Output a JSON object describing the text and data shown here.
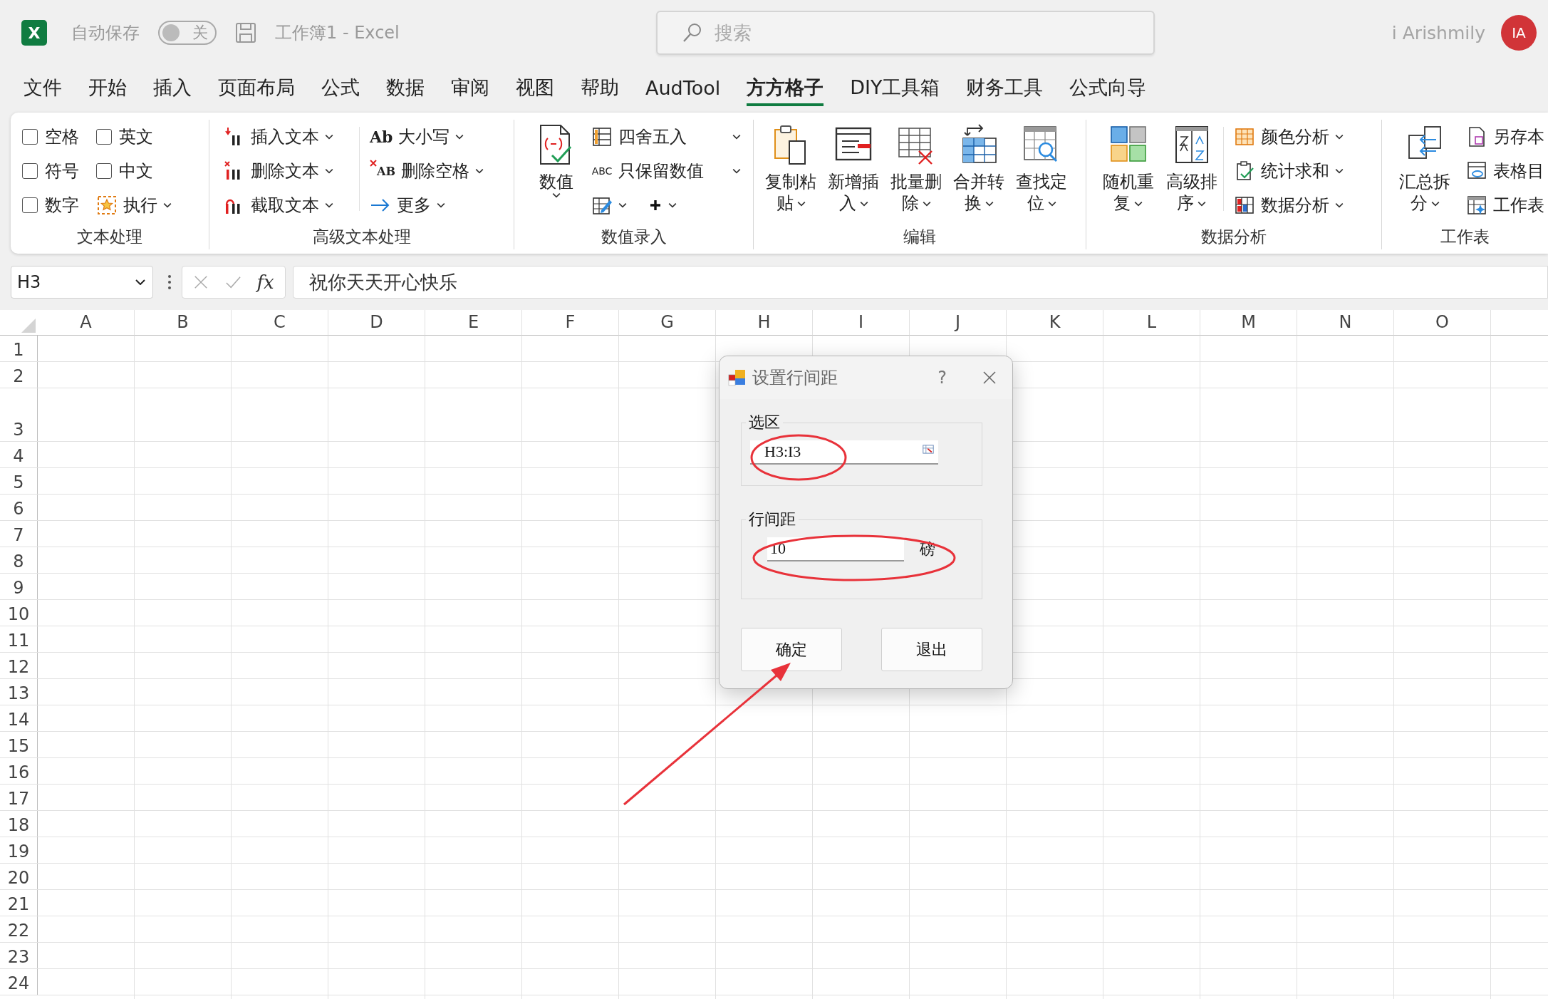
{
  "title_bar": {
    "logo_letter": "X",
    "autosave_label": "自动保存",
    "autosave_toggle": {
      "label": "关",
      "on": false
    },
    "document_title": "工作簿1  -  Excel",
    "search": {
      "placeholder": "搜索"
    },
    "user_name": "i Arishmily",
    "avatar_initials": "IA"
  },
  "menu_tabs": [
    {
      "label": "文件",
      "selected": false
    },
    {
      "label": "开始",
      "selected": false
    },
    {
      "label": "插入",
      "selected": false
    },
    {
      "label": "页面布局",
      "selected": false
    },
    {
      "label": "公式",
      "selected": false
    },
    {
      "label": "数据",
      "selected": false
    },
    {
      "label": "审阅",
      "selected": false
    },
    {
      "label": "视图",
      "selected": false
    },
    {
      "label": "帮助",
      "selected": false
    },
    {
      "label": "AudTool",
      "selected": false
    },
    {
      "label": "方方格子",
      "selected": true
    },
    {
      "label": "DIY工具箱",
      "selected": false
    },
    {
      "label": "财务工具",
      "selected": false
    },
    {
      "label": "公式向导",
      "selected": false
    }
  ],
  "ribbon": {
    "text_processing": {
      "label": "文本处理",
      "checkboxes": [
        {
          "label": "空格",
          "checked": false
        },
        {
          "label": "英文",
          "checked": false
        },
        {
          "label": "符号",
          "checked": false
        },
        {
          "label": "中文",
          "checked": false
        },
        {
          "label": "数字",
          "checked": false
        }
      ],
      "run_button": "执行"
    },
    "advanced_text": {
      "label": "高级文本处理",
      "buttons": [
        "插入文本",
        "删除文本",
        "截取文本"
      ],
      "text_buttons": [
        {
          "icon_text": "Ab",
          "label": "大小写"
        },
        {
          "icon_text": "AB",
          "label": "删除空格"
        },
        {
          "label": "更多"
        }
      ]
    },
    "number_entry": {
      "label": "数值录入",
      "large_button": "数值",
      "buttons": [
        {
          "label": "四舍五入"
        },
        {
          "icon_text": "ABC",
          "label": "只保留数值"
        }
      ]
    },
    "edit": {
      "label": "编辑",
      "buttons": [
        "复制粘贴",
        "新增插入",
        "批量删除",
        "合并转换",
        "查找定位"
      ]
    },
    "data_analysis": {
      "label": "数据分析",
      "large_buttons": [
        "随机重复",
        "高级排序"
      ],
      "buttons": [
        "颜色分析",
        "统计求和",
        "数据分析"
      ]
    },
    "worksheet": {
      "label": "工作表",
      "large_button": "汇总拆分",
      "buttons": [
        "另存本",
        "表格目",
        "工作表"
      ]
    }
  },
  "formula_bar": {
    "name_box": "H3",
    "function_label": "fx",
    "formula": "祝你天天开心快乐"
  },
  "sheet": {
    "columns": [
      "A",
      "B",
      "C",
      "D",
      "E",
      "F",
      "G",
      "H",
      "I",
      "J",
      "K",
      "L",
      "M",
      "N",
      "O"
    ],
    "rows": [
      {
        "label": "1",
        "tall": false
      },
      {
        "label": "2",
        "tall": false
      },
      {
        "label": "3",
        "tall": true
      },
      {
        "label": "4",
        "tall": false
      },
      {
        "label": "5",
        "tall": false
      },
      {
        "label": "6",
        "tall": false
      },
      {
        "label": "7",
        "tall": false
      },
      {
        "label": "8",
        "tall": false
      },
      {
        "label": "9",
        "tall": false
      },
      {
        "label": "10",
        "tall": false
      },
      {
        "label": "11",
        "tall": false
      },
      {
        "label": "12",
        "tall": false
      },
      {
        "label": "13",
        "tall": false
      },
      {
        "label": "14",
        "tall": false
      },
      {
        "label": "15",
        "tall": false
      },
      {
        "label": "16",
        "tall": false
      },
      {
        "label": "17",
        "tall": false
      },
      {
        "label": "18",
        "tall": false
      },
      {
        "label": "19",
        "tall": false
      },
      {
        "label": "20",
        "tall": false
      },
      {
        "label": "21",
        "tall": false
      },
      {
        "label": "22",
        "tall": false
      },
      {
        "label": "23",
        "tall": false
      },
      {
        "label": "24",
        "tall": false
      }
    ]
  },
  "dialog": {
    "title": "设置行间距",
    "help_label": "?",
    "selection_group": {
      "label": "选区",
      "value": "H3:I3"
    },
    "spacing_group": {
      "label": "行间距",
      "value": "10",
      "unit": "磅"
    },
    "buttons": [
      "确定",
      "退出"
    ]
  }
}
